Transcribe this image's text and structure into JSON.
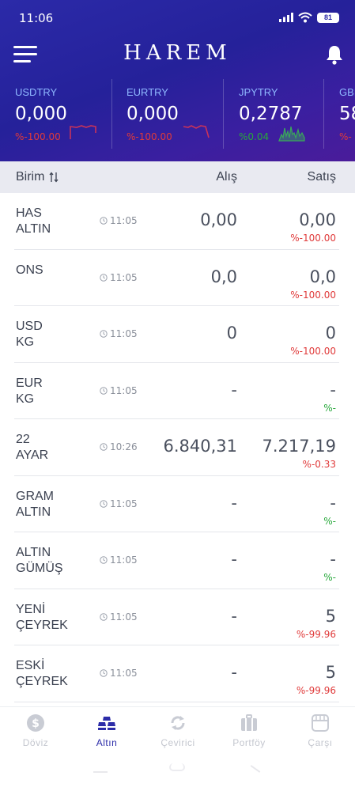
{
  "status_bar": {
    "time": "11:06",
    "battery": "81"
  },
  "header": {
    "brand": "HAREM"
  },
  "ticker": [
    {
      "symbol": "USDTRY",
      "value": "0,000",
      "change": "%-100.00",
      "trend": "down"
    },
    {
      "symbol": "EURTRY",
      "value": "0,000",
      "change": "%-100.00",
      "trend": "down"
    },
    {
      "symbol": "JPYTRY",
      "value": "0,2787",
      "change": "%0.04",
      "trend": "up"
    },
    {
      "symbol": "GBPTRY",
      "value": "58",
      "change": "%-",
      "trend": "down"
    }
  ],
  "columns": {
    "birim": "Birim",
    "alis": "Alış",
    "satis": "Satış"
  },
  "rows": [
    {
      "name": "HAS\nALTIN",
      "time": "11:05",
      "alis": "0,00",
      "satis": "0,00",
      "change": "%-100.00",
      "dir": "neg"
    },
    {
      "name": "ONS",
      "time": "11:05",
      "alis": "0,0",
      "satis": "0,0",
      "change": "%-100.00",
      "dir": "neg"
    },
    {
      "name": "USD\nKG",
      "time": "11:05",
      "alis": "0",
      "satis": "0",
      "change": "%-100.00",
      "dir": "neg"
    },
    {
      "name": "EUR\nKG",
      "time": "11:05",
      "alis": "-",
      "satis": "-",
      "change": "%-",
      "dir": "pos"
    },
    {
      "name": "22\nAYAR",
      "time": "10:26",
      "alis": "6.840,31",
      "satis": "7.217,19",
      "change": "%-0.33",
      "dir": "neg"
    },
    {
      "name": "GRAM\nALTIN",
      "time": "11:05",
      "alis": "-",
      "satis": "-",
      "change": "%-",
      "dir": "pos"
    },
    {
      "name": "ALTIN\nGÜMÜŞ",
      "time": "11:05",
      "alis": "-",
      "satis": "-",
      "change": "%-",
      "dir": "pos"
    },
    {
      "name": "YENİ\nÇEYREK",
      "time": "11:05",
      "alis": "-",
      "satis": "5",
      "change": "%-99.96",
      "dir": "neg"
    },
    {
      "name": "ESKİ\nÇEYREK",
      "time": "11:05",
      "alis": "-",
      "satis": "5",
      "change": "%-99.96",
      "dir": "neg"
    }
  ],
  "nav": [
    {
      "label": "Döviz",
      "icon": "currency-icon",
      "active": false
    },
    {
      "label": "Altın",
      "icon": "gold-bars-icon",
      "active": true
    },
    {
      "label": "Çevirici",
      "icon": "converter-icon",
      "active": false
    },
    {
      "label": "Portföy",
      "icon": "briefcase-icon",
      "active": false
    },
    {
      "label": "Çarşı",
      "icon": "market-icon",
      "active": false
    }
  ],
  "colors": {
    "header_start": "#2b2aa8",
    "header_end": "#4a1c9a",
    "negative": "#e03a3a",
    "positive": "#27a83a",
    "active_nav": "#2c2ca8",
    "ticker_symbol": "#8fb8ff"
  }
}
